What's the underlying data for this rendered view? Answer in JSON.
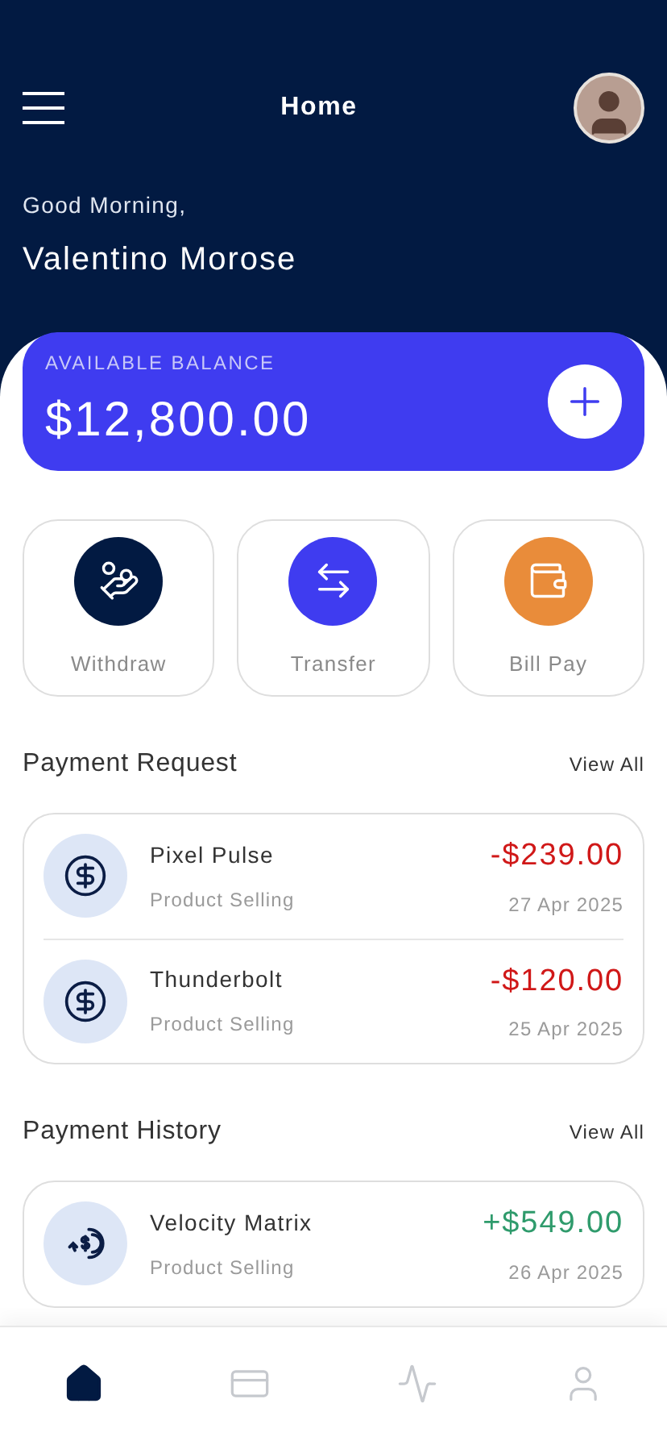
{
  "header": {
    "title": "Home",
    "greeting": "Good Morning,",
    "user_name": "Valentino Morose"
  },
  "balance": {
    "label": "AVAILABLE BALANCE",
    "amount": "$12,800.00"
  },
  "actions": [
    {
      "label": "Withdraw",
      "kind": "withdraw",
      "color": "#021a42"
    },
    {
      "label": "Transfer",
      "kind": "transfer",
      "color": "#3f3cf0"
    },
    {
      "label": "Bill Pay",
      "kind": "wallet",
      "color": "#e98c3a"
    }
  ],
  "payment_request": {
    "title": "Payment Request",
    "link": "View All",
    "items": [
      {
        "name": "Pixel Pulse",
        "category": "Product Selling",
        "amount": "-$239.00",
        "date": "27 Apr 2025",
        "kind": "debit"
      },
      {
        "name": "Thunderbolt",
        "category": "Product Selling",
        "amount": "-$120.00",
        "date": "25 Apr 2025",
        "kind": "debit"
      }
    ]
  },
  "payment_history": {
    "title": "Payment History",
    "link": "View All",
    "items": [
      {
        "name": "Velocity Matrix",
        "category": "Product Selling",
        "amount": "+$549.00",
        "date": "26 Apr 2025",
        "kind": "credit"
      }
    ]
  },
  "bottom_nav": [
    {
      "kind": "home",
      "selected": true
    },
    {
      "kind": "card",
      "selected": false
    },
    {
      "kind": "activity",
      "selected": false
    },
    {
      "kind": "profile",
      "selected": false
    }
  ]
}
